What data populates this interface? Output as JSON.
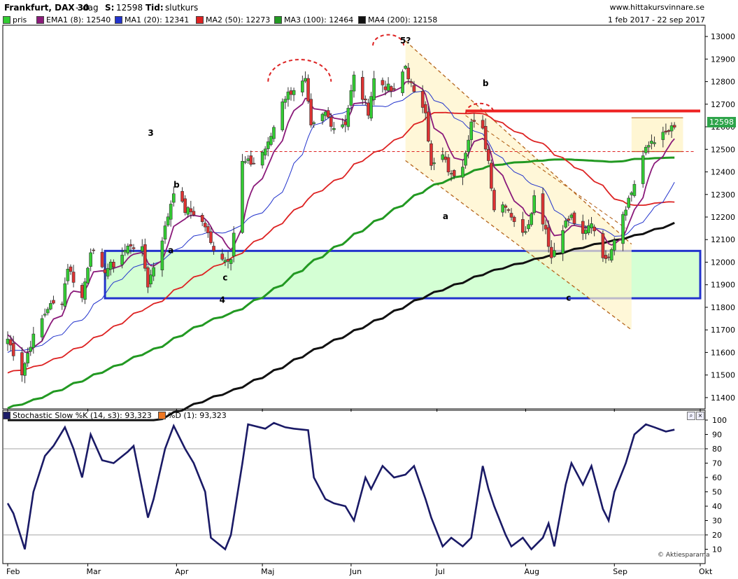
{
  "header": {
    "instrument": "Frankfurt, DAX 30",
    "sep": "-",
    "period": "dag",
    "s_label": "S:",
    "s_value": "12598",
    "tid_label": "Tid:",
    "tid_value": "slutkurs",
    "site": "www.hittakursvinnare.se"
  },
  "legend": [
    {
      "label": "pris",
      "color": "#33cc33"
    },
    {
      "label": "EMA1 (8): 12540",
      "color": "#8b1a7a"
    },
    {
      "label": "MA1 (20): 12341",
      "color": "#2233cc"
    },
    {
      "label": "MA2 (50): 12273",
      "color": "#dd2222"
    },
    {
      "label": "MA3 (100): 12464",
      "color": "#229922"
    },
    {
      "label": "MA4 (200): 12158",
      "color": "#111111"
    }
  ],
  "date_range": "1 feb 2017 - 22 sep 2017",
  "last_price_tag": "12598",
  "stoch_legend": [
    {
      "label": "Stochastic Slow %K (14, s3): 93,323",
      "color": "#1a1a66"
    },
    {
      "label": "%D (1): 93,323",
      "color": "#ee7722"
    }
  ],
  "watermark": "© Aktiespararna",
  "colors": {
    "up": "#33cc33",
    "down": "#dd3333",
    "ema8": "#8b1a7a",
    "ma20": "#2233cc",
    "ma50": "#dd2222",
    "ma100": "#229922",
    "ma200": "#111111",
    "stoch": "#1a1a66",
    "box_fill": "#ccffcc",
    "box_stroke": "#2233cc",
    "channel_fill": "#fff4c8",
    "channel_stroke": "#b5651d",
    "resistance": "#ee2222"
  },
  "chart_data": [
    {
      "type": "candlestick",
      "title": "Frankfurt, DAX 30",
      "x_ticks": [
        "Feb",
        "Mar",
        "Apr",
        "Maj",
        "Jun",
        "Jul",
        "Aug",
        "Sep",
        "Okt"
      ],
      "ylim": [
        11350,
        13050
      ],
      "y_ticks": [
        11400,
        11500,
        11600,
        11700,
        11800,
        11900,
        12000,
        12100,
        12200,
        12300,
        12400,
        12500,
        12600,
        12700,
        12800,
        12900,
        13000
      ],
      "close_anchors": [
        {
          "date": "2017-02-01",
          "close": 11660
        },
        {
          "date": "2017-02-06",
          "close": 11510
        },
        {
          "date": "2017-02-09",
          "close": 11640
        },
        {
          "date": "2017-02-15",
          "close": 11800
        },
        {
          "date": "2017-02-20",
          "close": 11830
        },
        {
          "date": "2017-02-22",
          "close": 11980
        },
        {
          "date": "2017-02-27",
          "close": 11840
        },
        {
          "date": "2017-03-02",
          "close": 12060
        },
        {
          "date": "2017-03-06",
          "close": 11960
        },
        {
          "date": "2017-03-10",
          "close": 11990
        },
        {
          "date": "2017-03-16",
          "close": 12080
        },
        {
          "date": "2017-03-20",
          "close": 12050
        },
        {
          "date": "2017-03-22",
          "close": 11900
        },
        {
          "date": "2017-03-28",
          "close": 12150
        },
        {
          "date": "2017-03-31",
          "close": 12320
        },
        {
          "date": "2017-04-04",
          "close": 12230
        },
        {
          "date": "2017-04-07",
          "close": 12220
        },
        {
          "date": "2017-04-11",
          "close": 12160
        },
        {
          "date": "2017-04-13",
          "close": 12080
        },
        {
          "date": "2017-04-18",
          "close": 12010
        },
        {
          "date": "2017-04-20",
          "close": 12030
        },
        {
          "date": "2017-04-24",
          "close": 12440
        },
        {
          "date": "2017-04-28",
          "close": 12440
        },
        {
          "date": "2017-05-03",
          "close": 12520
        },
        {
          "date": "2017-05-08",
          "close": 12720
        },
        {
          "date": "2017-05-12",
          "close": 12770
        },
        {
          "date": "2017-05-16",
          "close": 12800
        },
        {
          "date": "2017-05-18",
          "close": 12590
        },
        {
          "date": "2017-05-23",
          "close": 12660
        },
        {
          "date": "2017-05-26",
          "close": 12600
        },
        {
          "date": "2017-05-30",
          "close": 12620
        },
        {
          "date": "2017-06-02",
          "close": 12820
        },
        {
          "date": "2017-06-07",
          "close": 12670
        },
        {
          "date": "2017-06-09",
          "close": 12810
        },
        {
          "date": "2017-06-13",
          "close": 12780
        },
        {
          "date": "2017-06-16",
          "close": 12750
        },
        {
          "date": "2017-06-20",
          "close": 12870
        },
        {
          "date": "2017-06-23",
          "close": 12740
        },
        {
          "date": "2017-06-27",
          "close": 12680
        },
        {
          "date": "2017-06-29",
          "close": 12420
        },
        {
          "date": "2017-07-03",
          "close": 12470
        },
        {
          "date": "2017-07-06",
          "close": 12380
        },
        {
          "date": "2017-07-10",
          "close": 12440
        },
        {
          "date": "2017-07-13",
          "close": 12620
        },
        {
          "date": "2017-07-17",
          "close": 12580
        },
        {
          "date": "2017-07-19",
          "close": 12450
        },
        {
          "date": "2017-07-21",
          "close": 12240
        },
        {
          "date": "2017-07-25",
          "close": 12260
        },
        {
          "date": "2017-07-27",
          "close": 12210
        },
        {
          "date": "2017-07-31, \"close\": 12120"
        },
        {
          "date": "2017-08-02",
          "close": 12180
        },
        {
          "date": "2017-08-04",
          "close": 12290
        },
        {
          "date": "2017-08-08",
          "close": 12150
        },
        {
          "date": "2017-08-10",
          "close": 12020
        },
        {
          "date": "2017-08-14",
          "close": 12160
        },
        {
          "date": "2017-08-17",
          "close": 12200
        },
        {
          "date": "2017-08-21",
          "close": 12110
        },
        {
          "date": "2017-08-24",
          "close": 12180
        },
        {
          "date": "2017-08-29",
          "close": 12000
        },
        {
          "date": "2017-09-01",
          "close": 12110
        },
        {
          "date": "2017-09-04",
          "close": 12220
        },
        {
          "date": "2017-09-07",
          "close": 12310
        },
        {
          "date": "2017-09-11",
          "close": 12470
        },
        {
          "date": "2017-09-14",
          "close": 12540
        },
        {
          "date": "2017-09-18",
          "close": 12560
        },
        {
          "date": "2017-09-22",
          "close": 12598
        }
      ],
      "annotations": [
        {
          "text": "3",
          "date": "2017-03-23",
          "price": 12560
        },
        {
          "text": "b",
          "date": "2017-04-01",
          "price": 12330
        },
        {
          "text": "a",
          "date": "2017-03-30",
          "price": 12040
        },
        {
          "text": "c",
          "date": "2017-04-18",
          "price": 11920
        },
        {
          "text": "4",
          "date": "2017-04-17",
          "price": 11820
        },
        {
          "text": "5?",
          "date": "2017-06-20",
          "price": 12970
        },
        {
          "text": "b",
          "date": "2017-07-18",
          "price": 12780
        },
        {
          "text": "a",
          "date": "2017-07-04",
          "price": 12190
        },
        {
          "text": "c",
          "date": "2017-08-16",
          "price": 11830
        }
      ],
      "support_box": {
        "from": "2017-03-07",
        "to": "2017-10-01",
        "low": 11840,
        "high": 12050
      },
      "resistance_line": {
        "from": "2017-07-11",
        "to": "2017-10-01",
        "price": 12670
      },
      "dashed_level": {
        "from": "2017-04-25",
        "to": "2017-09-29",
        "price": 12490
      },
      "channel": {
        "upper": [
          {
            "date": "2017-06-20",
            "price": 12980
          },
          {
            "date": "2017-09-07",
            "price": 12080
          }
        ],
        "lower": [
          {
            "date": "2017-06-20",
            "price": 12450
          },
          {
            "date": "2017-09-07",
            "price": 11700
          }
        ]
      },
      "consolidation_box": {
        "from": "2017-09-07",
        "to": "2017-09-25",
        "low": 12490,
        "high": 12640
      },
      "series": [
        {
          "name": "EMA1 (8)",
          "type": "line"
        },
        {
          "name": "MA1 (20)",
          "type": "line"
        },
        {
          "name": "MA2 (50)",
          "type": "line"
        },
        {
          "name": "MA3 (100)",
          "type": "line"
        },
        {
          "name": "MA4 (200)",
          "type": "line"
        }
      ]
    },
    {
      "type": "line",
      "title": "Stochastic Slow %K (14, s3)",
      "ylim": [
        0,
        100
      ],
      "y_ticks": [
        10,
        20,
        30,
        40,
        50,
        60,
        70,
        80,
        90,
        100
      ],
      "grid_lines": [
        20,
        80
      ],
      "series": [
        {
          "name": "Stochastic Slow %K (14, s3)",
          "points": [
            {
              "date": "2017-02-01",
              "value": 42
            },
            {
              "date": "2017-02-03",
              "value": 35
            },
            {
              "date": "2017-02-07",
              "value": 10
            },
            {
              "date": "2017-02-10",
              "value": 50
            },
            {
              "date": "2017-02-14",
              "value": 75
            },
            {
              "date": "2017-02-17",
              "value": 82
            },
            {
              "date": "2017-02-21",
              "value": 95
            },
            {
              "date": "2017-02-24",
              "value": 80
            },
            {
              "date": "2017-02-27",
              "value": 60
            },
            {
              "date": "2017-03-02",
              "value": 90
            },
            {
              "date": "2017-03-06",
              "value": 72
            },
            {
              "date": "2017-03-10",
              "value": 70
            },
            {
              "date": "2017-03-15",
              "value": 78
            },
            {
              "date": "2017-03-17",
              "value": 82
            },
            {
              "date": "2017-03-22",
              "value": 32
            },
            {
              "date": "2017-03-24",
              "value": 45
            },
            {
              "date": "2017-03-28",
              "value": 80
            },
            {
              "date": "2017-03-31",
              "value": 96
            },
            {
              "date": "2017-04-04",
              "value": 80
            },
            {
              "date": "2017-04-07",
              "value": 70
            },
            {
              "date": "2017-04-11",
              "value": 50
            },
            {
              "date": "2017-04-13",
              "value": 18
            },
            {
              "date": "2017-04-18",
              "value": 10
            },
            {
              "date": "2017-04-20",
              "value": 20
            },
            {
              "date": "2017-04-24",
              "value": 70
            },
            {
              "date": "2017-04-26",
              "value": 97
            },
            {
              "date": "2017-05-02",
              "value": 94
            },
            {
              "date": "2017-05-05",
              "value": 98
            },
            {
              "date": "2017-05-09",
              "value": 95
            },
            {
              "date": "2017-05-12",
              "value": 94
            },
            {
              "date": "2017-05-17",
              "value": 93
            },
            {
              "date": "2017-05-19",
              "value": 60
            },
            {
              "date": "2017-05-23",
              "value": 45
            },
            {
              "date": "2017-05-26",
              "value": 42
            },
            {
              "date": "2017-05-30",
              "value": 40
            },
            {
              "date": "2017-06-02",
              "value": 30
            },
            {
              "date": "2017-06-06",
              "value": 60
            },
            {
              "date": "2017-06-08",
              "value": 52
            },
            {
              "date": "2017-06-12",
              "value": 68
            },
            {
              "date": "2017-06-16",
              "value": 60
            },
            {
              "date": "2017-06-20",
              "value": 62
            },
            {
              "date": "2017-06-23",
              "value": 68
            },
            {
              "date": "2017-06-27",
              "value": 45
            },
            {
              "date": "2017-06-29",
              "value": 32
            },
            {
              "date": "2017-07-03",
              "value": 12
            },
            {
              "date": "2017-07-06",
              "value": 18
            },
            {
              "date": "2017-07-10",
              "value": 12
            },
            {
              "date": "2017-07-13",
              "value": 18
            },
            {
              "date": "2017-07-17",
              "value": 68
            },
            {
              "date": "2017-07-19",
              "value": 52
            },
            {
              "date": "2017-07-21",
              "value": 40
            },
            {
              "date": "2017-07-25",
              "value": 20
            },
            {
              "date": "2017-07-27",
              "value": 12
            },
            {
              "date": "2017-07-31",
              "value": 18
            },
            {
              "date": "2017-08-03",
              "value": 10
            },
            {
              "date": "2017-08-07",
              "value": 18
            },
            {
              "date": "2017-08-09",
              "value": 28
            },
            {
              "date": "2017-08-11",
              "value": 12
            },
            {
              "date": "2017-08-15",
              "value": 55
            },
            {
              "date": "2017-08-17",
              "value": 70
            },
            {
              "date": "2017-08-21",
              "value": 55
            },
            {
              "date": "2017-08-24",
              "value": 68
            },
            {
              "date": "2017-08-28",
              "value": 38
            },
            {
              "date": "2017-08-30",
              "value": 30
            },
            {
              "date": "2017-09-01",
              "value": 50
            },
            {
              "date": "2017-09-05",
              "value": 70
            },
            {
              "date": "2017-09-08",
              "value": 90
            },
            {
              "date": "2017-09-12",
              "value": 97
            },
            {
              "date": "2017-09-15",
              "value": 95
            },
            {
              "date": "2017-09-19",
              "value": 92
            },
            {
              "date": "2017-09-22",
              "value": 93.3
            }
          ]
        }
      ]
    }
  ]
}
